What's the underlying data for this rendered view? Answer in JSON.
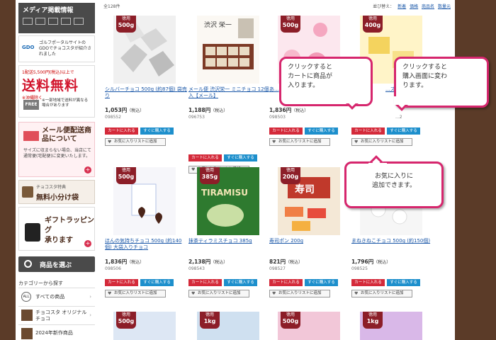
{
  "sidebar": {
    "media_title": "メディア掲載情報",
    "gdo_logo": "GDO",
    "gdo_text": "ゴルフポータルサイトのGDOでチョコスタが紹介されました",
    "shipping": {
      "top": "1配送5,500円(税込)以上で",
      "big": "送料無料",
      "note": "※沖縄除く",
      "free_tag": "FREE",
      "small": "※一部地域で送料が異なる場合があります"
    },
    "mail": {
      "title": "メール便配送商品について",
      "desc": "サイズに収まらない場合、当店にて通常便(宅配便)に変更いたします。"
    },
    "sample": {
      "small": "チョコスタ特典",
      "big": "無料小分け袋"
    },
    "gift": {
      "line1": "ギフトラッピング",
      "line2": "承ります"
    },
    "select_label": "商品を選ぶ",
    "category_label": "カテゴリーから探す",
    "categories": [
      {
        "badge": "ALL",
        "label": "すべての商品"
      },
      {
        "badge": "",
        "label": "チョコスタ オリジナルチョコ"
      },
      {
        "badge": "",
        "label": "2024年新作商品"
      }
    ]
  },
  "main": {
    "count": "全128件",
    "sort_label": "並び替え：",
    "sort_options": [
      "新着",
      "価格",
      "商品名",
      "数量元"
    ],
    "buttons": {
      "cart": "カートに入れる",
      "buy": "すぐに購入する",
      "fav": "お気に入りリストに追加"
    },
    "products": [
      {
        "badge_top": "徳用",
        "badge_weight": "500g",
        "name": "シルバーチョコ 500g (約87個) 袋売り",
        "price": "1,053円",
        "tax": "（税込）",
        "code": "098552"
      },
      {
        "badge_top": "",
        "badge_weight": "",
        "name": "メール便 渋沢栄一 ミニチョコ 12個入【メール】",
        "price": "1,188円",
        "tax": "（税込）",
        "code": "096753"
      },
      {
        "badge_top": "徳用",
        "badge_weight": "500g",
        "name": "あ...",
        "price": "1,836円",
        "tax": "（税込）",
        "code": "098503"
      },
      {
        "badge_top": "徳用",
        "badge_weight": "400g",
        "name": "...ズ...",
        "price": "",
        "tax": "",
        "code": "...2"
      },
      {
        "badge_top": "徳用",
        "badge_weight": "500g",
        "name": "ほんの気持ちチョコ 500g (約140個) 大袋入りチョコ",
        "price": "1,836円",
        "tax": "（税込）",
        "code": "098506"
      },
      {
        "badge_top": "徳用",
        "badge_weight": "385g",
        "name": "抹茶ティラミスチョコ 385g",
        "price": "2,138円",
        "tax": "（税込）",
        "code": "098543"
      },
      {
        "badge_top": "徳用",
        "badge_weight": "200g",
        "name": "寿司ポン 200g",
        "price": "821円",
        "tax": "（税込）",
        "code": "098527"
      },
      {
        "badge_top": "徳用",
        "badge_weight": "500g",
        "name": "まねきねこチョコ 500g (約150個)",
        "price": "1,796円",
        "tax": "（税込）",
        "code": "098525"
      },
      {
        "badge_top": "徳用",
        "badge_weight": "500g"
      },
      {
        "badge_top": "徳用",
        "badge_weight": "1kg"
      },
      {
        "badge_top": "徳用",
        "badge_weight": "500g"
      },
      {
        "badge_top": "徳用",
        "badge_weight": "1kg"
      }
    ]
  },
  "callouts": {
    "cart": "クリックすると\nカートに商品が\n入ります。",
    "buy": "クリックすると\n購入画面に変わ\nります。",
    "fav": "お気に入りに\n追加できます。"
  },
  "colors": {
    "accent": "#d6266d",
    "cart_btn": "#d42a3a",
    "buy_btn": "#1d8fcc",
    "badge": "#8c1e28",
    "frame": "#5b3b28"
  }
}
